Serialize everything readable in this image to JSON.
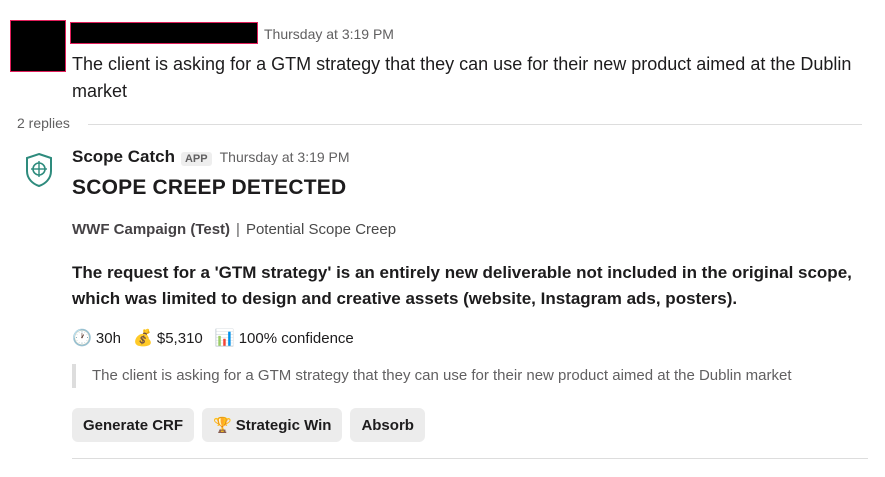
{
  "message1": {
    "timestamp": "Thursday at 3:19 PM",
    "text": "The client is asking for a GTM strategy that they can use for their new product aimed at the Dublin market"
  },
  "thread": {
    "replies_label": "2 replies"
  },
  "app_message": {
    "app_name": "Scope Catch",
    "badge": "APP",
    "timestamp": "Thursday at 3:19 PM",
    "alert_title": "SCOPE CREEP DETECTED",
    "project": "WWF Campaign (Test)",
    "separator": "|",
    "status": "Potential Scope Creep",
    "reason": "The request for a 'GTM strategy' is an entirely new deliverable not included in the original scope, which was limited to design and creative assets (website, Instagram ads, posters).",
    "metrics": {
      "hours_icon": "🕐",
      "hours": "30h",
      "cost_icon": "💰",
      "cost": "$5,310",
      "confidence_icon": "📊",
      "confidence": "100% confidence"
    },
    "quote": "The client is asking for a GTM strategy that they can use for their new product aimed at the Dublin market",
    "buttons": {
      "generate_crf": "Generate CRF",
      "strategic_win_icon": "🏆",
      "strategic_win": "Strategic Win",
      "absorb": "Absorb"
    }
  },
  "colors": {
    "redaction": "#000000",
    "redaction_border": "#e01e5a",
    "app_logo": "#2e8b7d"
  }
}
